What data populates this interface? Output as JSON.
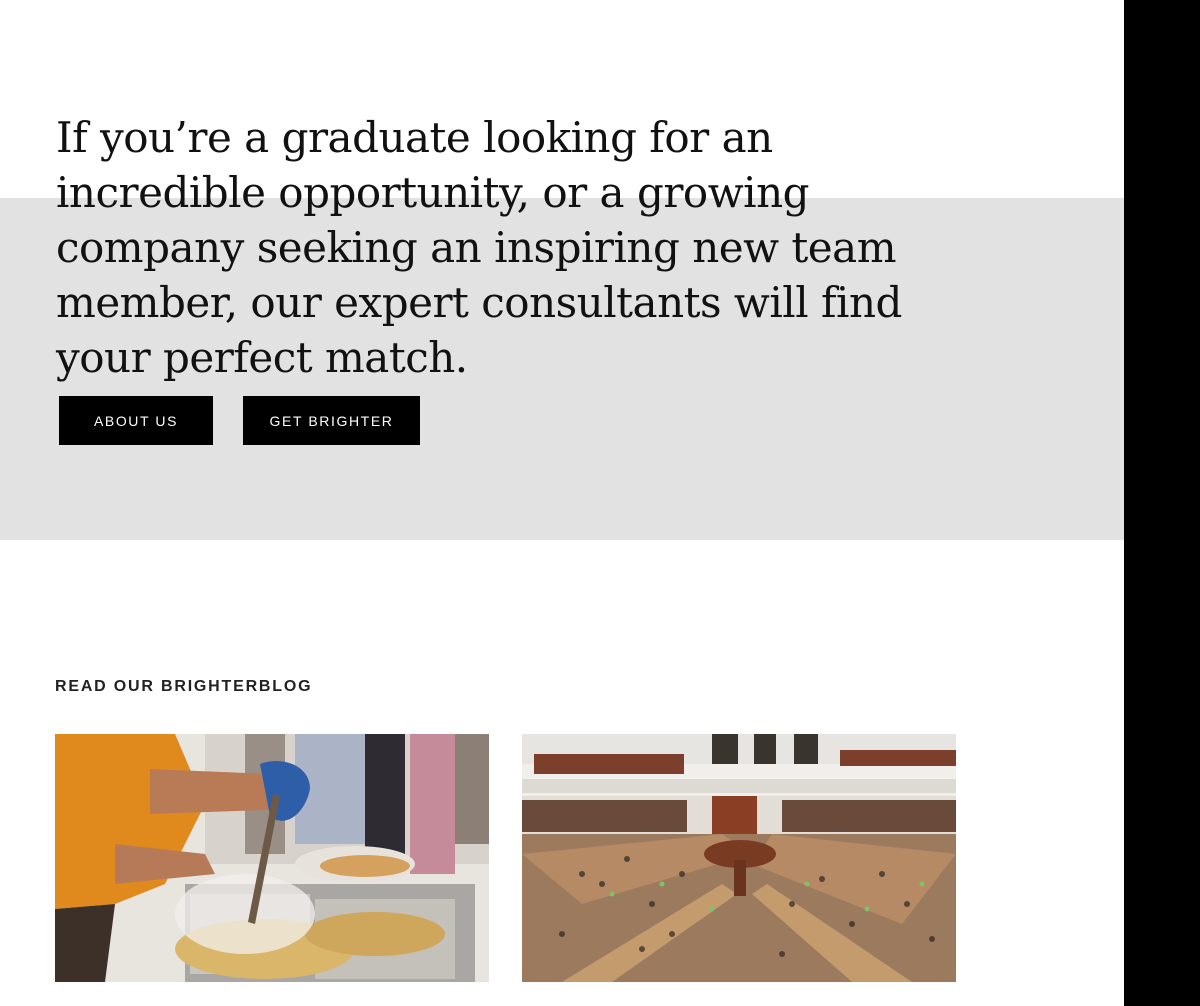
{
  "hero": {
    "intro": "If you’re a graduate looking for an incredible opportunity, or a growing company seeking an inspiring new team member, our expert consultants will find your perfect match."
  },
  "buttons": {
    "about_label": "ABOUT US",
    "get_label": "GET BRIGHTER"
  },
  "blog": {
    "heading": "READ OUR BRIGHTERBLOG",
    "posts": [
      {
        "image": "food-serving-photo"
      },
      {
        "image": "library-reading-room-photo"
      }
    ]
  },
  "colors": {
    "band": "#e2e2e2",
    "button_bg": "#000000",
    "button_text": "#ffffff",
    "side_strip": "#000000"
  }
}
